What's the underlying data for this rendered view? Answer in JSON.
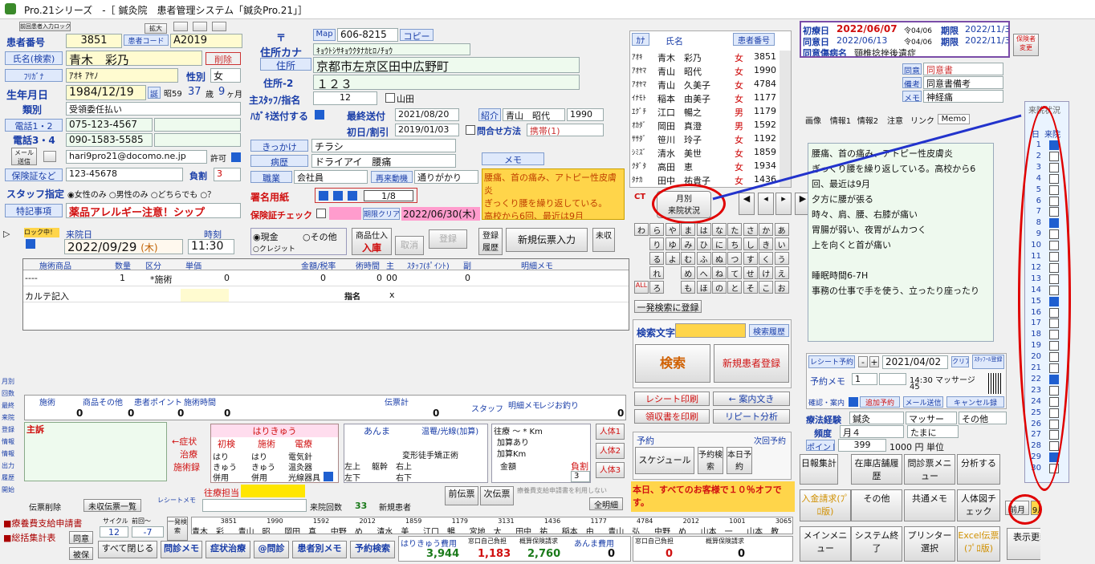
{
  "title": "Pro.21シリーズ　-［ 鍼灸院　患者管理システム「鍼灸Pro.21」］",
  "top_small": [
    "前回患者入力ロック",
    "拡大",
    "簡易表示"
  ],
  "patient": {
    "no_label": "患者番号",
    "no": "3851",
    "code_label": "患者コード",
    "code": "A2019",
    "name_label": "氏名(検索)",
    "name": "青木　彩乃",
    "delete": "削除",
    "kana_label": "ﾌﾘｶﾞﾅ",
    "kana": "ｱｵｷ ｱﾔﾉ",
    "sex_label": "性別",
    "sex": "女",
    "dob_label": "生年月日",
    "dob": "1984/12/19",
    "era": "誕",
    "era2": "昭59",
    "age": "37",
    "age_unit": "歳",
    "months": "9",
    "month_unit": "ヶ月",
    "type_label": "類別",
    "type": "受領委任払い",
    "tel12_label": "電話1・2",
    "tel1": "075-123-4567",
    "tel34_label": "電話3・4",
    "tel3": "090-1583-5585",
    "mail_label": "メール送信",
    "mail": "hari9pro21@docomo.ne.jp",
    "permit": "許可",
    "insurance_label": "保険証など",
    "insurance": "123-45678",
    "burden_label": "負割",
    "burden": "3",
    "staff_label": "スタッフ指定",
    "staff_opts": [
      "女性のみ",
      "男性のみ",
      "どちらでも",
      "？"
    ],
    "notes_label": "特記事項",
    "notes": "薬品アレルギー注意！シップ"
  },
  "addr": {
    "zip_sym": "〒",
    "map": "Map",
    "zip": "606-8215",
    "copy": "コピー",
    "kana_label": "住所カナ",
    "kana": "ｷｮｳﾄｼｻｷｮｳｸﾀﾅｶﾋﾛﾉﾁｮｳ",
    "addr_label": "住所",
    "addr": "京都市左京区田中広野町",
    "addr2_label": "住所-2",
    "addr2": "１２３",
    "floor_label": "主ｽﾀｯﾌ/指名",
    "floor": "12",
    "floor2": "山田",
    "postcard_label": "ﾊｶﾞｷ送付する",
    "last_send_label": "最終送付",
    "last_send": "2021/08/20",
    "first_label": "初日/割引",
    "first": "2019/01/03",
    "intro_label": "紹介",
    "intro_name": "青山　昭代",
    "intro_no": "1990",
    "contact_label": "問合せ方法",
    "contact": "携帯(1)",
    "trigger_label": "きっかけ",
    "trigger": "チラシ",
    "memo_btn": "メモ",
    "illness_label": "病歴",
    "illness": "ドライアイ　腰痛",
    "job_label": "職業",
    "job": "会社員",
    "revisit": "再来動機",
    "revisit_val": "通りがかり",
    "memo_text": "腰痛、首の痛み、アトピー性皮膚炎\nぎっくり腰を繰り返している。\n高校から6回、最近は9月",
    "sign_label": "署名用紙",
    "sign_page": "1/8",
    "hokencheck_label": "保険証チェック",
    "expire_label": "期限クリア",
    "expire": "2022/06/30(木)"
  },
  "patients_list": {
    "headers": [
      "ｶﾅ",
      "氏名",
      "",
      "患者番号"
    ],
    "rows": [
      [
        "ｱｵｷ",
        "青木　彩乃",
        "女",
        "3851"
      ],
      [
        "ｱｵﾔﾏ",
        "青山　昭代",
        "女",
        "1990"
      ],
      [
        "ｱｵﾔﾏ",
        "青山　久美子",
        "女",
        "4784"
      ],
      [
        "ｲﾅﾓﾄ",
        "稲本　由美子",
        "女",
        "1177"
      ],
      [
        "ｴｸﾞﾁ",
        "江口　暢之",
        "男",
        "1179"
      ],
      [
        "ｵｶﾀﾞ",
        "岡田　真澄",
        "男",
        "1592"
      ],
      [
        "ｻｻﾀﾞ",
        "笹川　玲子",
        "女",
        "1192"
      ],
      [
        "ｼﾐｽﾞ",
        "清水　美世",
        "女",
        "1859"
      ],
      [
        "ｸﾀﾞﾀ",
        "高田　恵",
        "女",
        "1934"
      ],
      [
        "ﾀﾅｶ",
        "田中　祐貴子",
        "女",
        "1436"
      ]
    ]
  },
  "monthly_btn": [
    "月別",
    "来院状況"
  ],
  "kana_grid": [
    "わ",
    "ら",
    "や",
    "ま",
    "は",
    "な",
    "た",
    "さ",
    "か",
    "あ",
    "",
    "り",
    "ゆ",
    "み",
    "ひ",
    "に",
    "ち",
    "し",
    "き",
    "い",
    "",
    "る",
    "よ",
    "む",
    "ふ",
    "ぬ",
    "つ",
    "す",
    "く",
    "う",
    "",
    "れ",
    "",
    "め",
    "へ",
    "ね",
    "て",
    "せ",
    "け",
    "え",
    "ALL",
    "ろ",
    "",
    "も",
    "ほ",
    "の",
    "と",
    "そ",
    "こ",
    "お"
  ],
  "search": {
    "register": "一発検索に登録",
    "text_label": "検索文字",
    "history": "検索履歴",
    "search_btn": "検索",
    "new_patient": "新規患者登録",
    "receipt_print": "レシート印刷",
    "guide": "← 案内文き",
    "print_receipt": "領収書を印刷",
    "repeat": "リピート分析",
    "reserve_label": "予約",
    "next_label": "次回予約",
    "schedule": "スケジュール",
    "reserve_search": "予約検索",
    "today": "本日予約",
    "promo": "本日、すべてのお客様で１０％オフです。"
  },
  "tabs": [
    "画像",
    "情報1",
    "情報2",
    "注意",
    "リンク",
    "Memo"
  ],
  "memo_lines": [
    "腰痛、首の痛み、アトピー性皮膚炎",
    "ぎっくり腰を繰り返している。高校から6",
    "回、最近は9月",
    "夕方に腰が張る",
    "時々、肩、腰、右膝が痛い",
    "胃腸が弱い、夜胃がムカつく",
    "上を向くと首が痛い",
    "",
    "睡眠時間6-7H",
    "事務の仕事で手を使う、立ったり座ったり"
  ],
  "right_top": {
    "first_label": "初療日",
    "first": "2022/06/07",
    "first_sub": "令04/06",
    "limit_label": "期限",
    "limit1": "2022/11/30",
    "same_label": "同意日",
    "same": "2022/06/13",
    "same_sub": "令04/06",
    "limit2": "2022/11/30",
    "disease_label": "同意傷病名",
    "disease": "頸椎捻挫後遺症",
    "hoken_btn": "保険者変更",
    "opt1_label": "同意",
    "opt1": "同意書",
    "opt2_label": "備考",
    "opt2": "同意書備考",
    "opt3_label": "メモ",
    "opt3": "神経痛"
  },
  "receipt_reserve": {
    "label": "レシート予約",
    "date": "2021/04/02",
    "clear": "クリア",
    "staff": "ｽﾀｯﾌｰﾙ登録",
    "memo_label": "予約メモ",
    "memo_no": "1",
    "time": "14:30 マッサージ",
    "dur": "45",
    "confirm": "確認・案内",
    "add": "追加予約",
    "mail": "メール送信",
    "cancel": "キャンセル録"
  },
  "therapy": {
    "label": "療法経験",
    "val1": "鍼灸",
    "val2": "マッサー",
    "val3": "その他",
    "freq_label": "頻度",
    "freq": "月４",
    "freq2": "たまに",
    "point_label": "ポイント",
    "point": "399",
    "unit": "1000 円 単位"
  },
  "bottom_right_btns": [
    "日報集計",
    "在庫店舗履歴",
    "問診票メニュー",
    "分析する",
    "入金請求(ﾌﾟﾛ版)",
    "その他",
    "共通メモ",
    "人体図チェック",
    "前月",
    "9月",
    "メインメニュー",
    "システム終了",
    "プリンター選択",
    "Excel伝票(ﾌﾟﾛ版)",
    "表示更新"
  ],
  "calendar": {
    "head": "来院状況",
    "col1": "日",
    "col2": "来院",
    "days": [
      "1",
      "2",
      "3",
      "4",
      "5",
      "6",
      "7",
      "8",
      "9",
      "10",
      "11",
      "12",
      "13",
      "14",
      "15",
      "16",
      "17",
      "18",
      "19",
      "20",
      "21",
      "22",
      "23",
      "24",
      "25",
      "26",
      "27",
      "28",
      "29",
      "30"
    ],
    "checked": [
      "1",
      "8",
      "15",
      "22",
      "29"
    ]
  },
  "visit": {
    "lock": "ロック中！",
    "date_label": "来院日",
    "date": "2022/09/29",
    "dow": "(木)",
    "time_label": "時刻",
    "time": "11:30",
    "pay_cash": "現金",
    "pay_other": "その他",
    "pay_credit": "クレジット",
    "goods": "商品仕入",
    "in_label": "入庫",
    "cancel": "取消",
    "register": "登録",
    "reg_hist": "登録履歴",
    "new_slip": "新規伝票入力",
    "unpaid": "未収"
  },
  "treat_table": {
    "headers": [
      "施術商品",
      "数量",
      "区分",
      "単価",
      "金額/税率",
      "術時間",
      "主",
      "ｽﾀｯﾌ(ﾎﾟｲﾝﾄ)",
      "副",
      "明細メモ"
    ],
    "row1": [
      "----",
      "1",
      "*施術",
      "0",
      "0",
      "0",
      "00",
      "",
      "0"
    ],
    "row2_label": "カルテ記入",
    "row2_sub": "指名",
    "row2_x": "x"
  },
  "totals": {
    "treat_label": "施術",
    "treat": "0",
    "goods_label": "商品その他",
    "goods": "0",
    "point_label": "患者ポイント",
    "point": "0",
    "time_label": "施術時間",
    "time": "0",
    "slip_label": "伝票計",
    "slip": "0",
    "sub": "伝票計値引",
    "staff": "スタッフ",
    "detail": "明細メモ",
    "reg": "レジお釣り",
    "z1": "0",
    "z2": "0"
  },
  "lower": {
    "complaint": "主訴",
    "symptom": "←症状",
    "cure": "治療",
    "treat_rec": "施術録",
    "hari_title": "はりきゅう",
    "first_label": "初検",
    "treat_label": "施術",
    "den_label": "電療",
    "hari": "はり",
    "kyu": "きゅう",
    "hei": "併用",
    "elec": "電気針",
    "onkyu": "温灸器",
    "hikari": "光線器具",
    "anma": "あんま",
    "onpu": "温罨/光線(加算)",
    "henkei": "変形徒手矯正術",
    "visit_label": "往療",
    "km": "～ * Km",
    "kasan": "加算あり",
    "kasan_km": "加算Km",
    "kingaku": "金額",
    "futan": "負割",
    "futan_val": "3",
    "body1": "人体1",
    "body2": "人体2",
    "body3": "人体3",
    "left": "左上",
    "trunk": "躯幹",
    "right": "右上",
    "lu": "左上",
    "ru": "右上",
    "ld": "左下",
    "rd": "右下",
    "lower_left": "左下",
    "lower_right": "右下",
    "staff_label": "往療担当",
    "prev": "前伝票",
    "next": "次伝票",
    "reimb": "療養費支給申請書を利用しない",
    "all": "全明細",
    "slip_del": "伝票削除",
    "unpaid_list": "未収伝票一覧",
    "receipt_memo": "レシートメモ",
    "count_label": "来院回数",
    "count": "33",
    "new_label": "新規患者"
  },
  "footer": {
    "r1": "療養費支給申請書",
    "r2": "総括集計表",
    "agree": "同意",
    "cancel": "被保",
    "cycle": "サイクル",
    "prev": "前回～",
    "c1": "12",
    "c2": "-7",
    "search": "一発検索",
    "close_all": "すべて閉じる",
    "interview_memo": "問診メモ",
    "symptom_treat": "症状治療",
    "interview": "@問診",
    "patient_memo": "患者別メモ",
    "reserve_search": "予約検索",
    "list": [
      [
        "3851",
        "青木　彩"
      ],
      [
        "1990",
        "青山　昭"
      ],
      [
        "1592",
        "岡田　真"
      ],
      [
        "2012",
        "中野　め"
      ],
      [
        "1859",
        "清水　美"
      ],
      [
        "1179",
        "江口　暢"
      ],
      [
        "3131",
        "宮地　太"
      ],
      [
        "1436",
        "田中　祐"
      ],
      [
        "1177",
        "稲本　由"
      ],
      [
        "4784",
        "青山　弘"
      ],
      [
        "2012",
        "中野　め"
      ],
      [
        "1001",
        "山本　一"
      ],
      [
        "3065",
        "山本　教"
      ]
    ],
    "hari_fee_label": "はりきゅう費用",
    "hari_fee": "3,944",
    "self1_label": "窓口自己負担",
    "self1": "1,183",
    "insure1_label": "概算保険請求",
    "insure1": "2,760",
    "anma_fee_label": "あんま費用",
    "anma_fee": "0",
    "self2_label": "窓口自己負担",
    "self2": "0",
    "insure2_label": "概算保険請求",
    "insure2": "0"
  },
  "left_side": [
    "月別",
    "回数",
    "最終",
    "来院",
    "登録",
    "情報",
    "情報",
    "出力",
    "履歴",
    "開始"
  ],
  "colors": {
    "accent": "#1a3ea8",
    "red": "#d01010",
    "yellow": "#ffd54a",
    "annot": "#e00000"
  }
}
